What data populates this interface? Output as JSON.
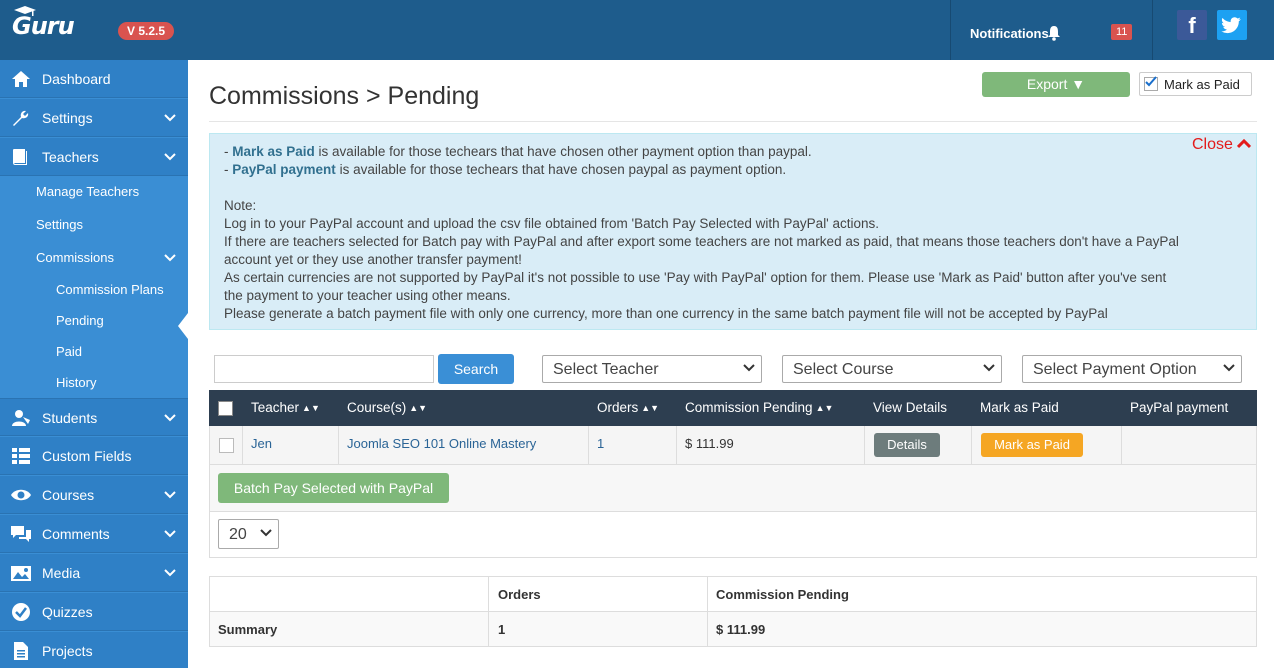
{
  "app": {
    "logo": "Guru",
    "version": "V 5.2.5"
  },
  "topbar": {
    "notifications_label": "Notifications",
    "notification_count": "11"
  },
  "sidebar": {
    "items": [
      {
        "label": "Dashboard",
        "icon": "home-icon"
      },
      {
        "label": "Settings",
        "icon": "wrench-icon"
      },
      {
        "label": "Teachers",
        "icon": "book-icon"
      },
      {
        "label": "Students",
        "icon": "students-icon"
      },
      {
        "label": "Custom Fields",
        "icon": "list-icon"
      },
      {
        "label": "Courses",
        "icon": "eye-icon"
      },
      {
        "label": "Comments",
        "icon": "comments-icon"
      },
      {
        "label": "Media",
        "icon": "image-icon"
      },
      {
        "label": "Quizzes",
        "icon": "check-circle-icon"
      },
      {
        "label": "Projects",
        "icon": "file-icon"
      }
    ],
    "teacher_sub": [
      "Manage Teachers",
      "Settings",
      "Commissions"
    ],
    "commission_sub": [
      "Commission Plans",
      "Pending",
      "Paid",
      "History"
    ]
  },
  "page": {
    "title": "Commissions > Pending",
    "export_label": "Export ▼",
    "mark_as_paid_check_label": "Mark as Paid"
  },
  "info": {
    "close_label": "Close",
    "line1_bold": "Mark as Paid",
    "line1_rest": " is available for those techears that have chosen other payment option than paypal.",
    "line2_bold": "PayPal payment",
    "line2_rest": " is available for those techears that have chosen paypal as payment option.",
    "note": "Note:",
    "n1": "Log in to your PayPal account and upload the csv file obtained from 'Batch Pay Selected with PayPal' actions.",
    "n2a": "If there are teachers selected for Batch pay with PayPal and after export some teachers are not marked as paid, that means those teachers don't have a PayPal",
    "n2b": "account yet or they use another transfer payment!",
    "n3a": "As certain currencies are not supported by PayPal it's not possible to use 'Pay with PayPal' option for them. Please use 'Mark as Paid' button after you've sent",
    "n3b": "the payment to your teacher using other means.",
    "n4": "Please generate a batch payment file with only one currency, more than one currency in the same batch payment file will not be accepted by PayPal"
  },
  "filters": {
    "search_value": "",
    "search_label": "Search",
    "teacher_select": "Select Teacher",
    "course_select": "Select Course",
    "payment_select": "Select Payment Option"
  },
  "table": {
    "columns": [
      "Teacher",
      "Course(s)",
      "Orders",
      "Commission Pending",
      "View Details",
      "Mark as Paid",
      "PayPal payment"
    ],
    "rows": [
      {
        "teacher": "Jen",
        "course": "Joomla SEO 101 Online Mastery",
        "orders": "1",
        "commission": "$ 111.99",
        "details_label": "Details",
        "mark_label": "Mark as Paid",
        "paypal": ""
      }
    ]
  },
  "batch_label": "Batch Pay Selected with PayPal",
  "limit_value": "20",
  "summary": {
    "headers": [
      "",
      "Orders",
      "Commission Pending"
    ],
    "row": [
      "Summary",
      "1",
      "$ 111.99"
    ]
  }
}
